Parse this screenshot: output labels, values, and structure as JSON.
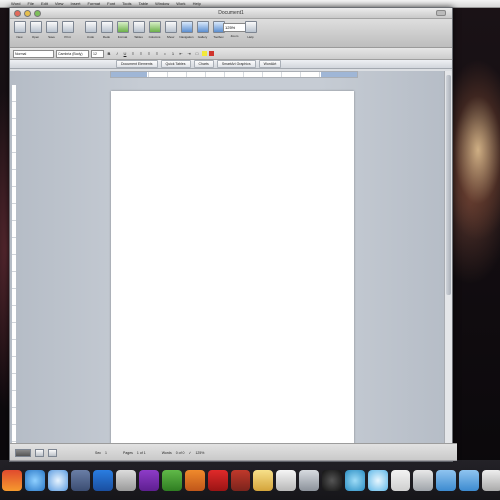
{
  "menubar": {
    "apple_glyph": "",
    "items": [
      "Word",
      "File",
      "Edit",
      "View",
      "Insert",
      "Format",
      "Font",
      "Tools",
      "Table",
      "Window",
      "Work",
      "Help"
    ]
  },
  "window": {
    "title": "Document1"
  },
  "toolbar": {
    "buttons": [
      "New",
      "Open",
      "Save",
      "Print",
      "Undo",
      "Redo",
      "Format",
      "Tables",
      "Columns",
      "Show",
      "Navigation",
      "Gallery",
      "Toolbox",
      "Zoom",
      "Help"
    ],
    "zoom_value": "125%"
  },
  "format_bar": {
    "style": "Normal",
    "font": "Cambria (Body)",
    "size": "12",
    "bold": "B",
    "italic": "I",
    "underline": "U",
    "highlight_color": "#f2e93a",
    "font_color": "#d0342c"
  },
  "ribbon": {
    "tabs": [
      "Document Elements",
      "Quick Tables",
      "Charts",
      "SmartArt Graphics",
      "WordArt"
    ]
  },
  "status_bar": {
    "sections_label": "Sec",
    "sections_value": "1",
    "pages_label": "Pages",
    "pages_value": "1 of 1",
    "words_label": "Words",
    "words_value": "0 of 0",
    "zoom_value": "125%"
  },
  "colors": {
    "accent": "#5c8fd0",
    "page": "#ffffff",
    "editor_bg": "#c6ccd4"
  }
}
